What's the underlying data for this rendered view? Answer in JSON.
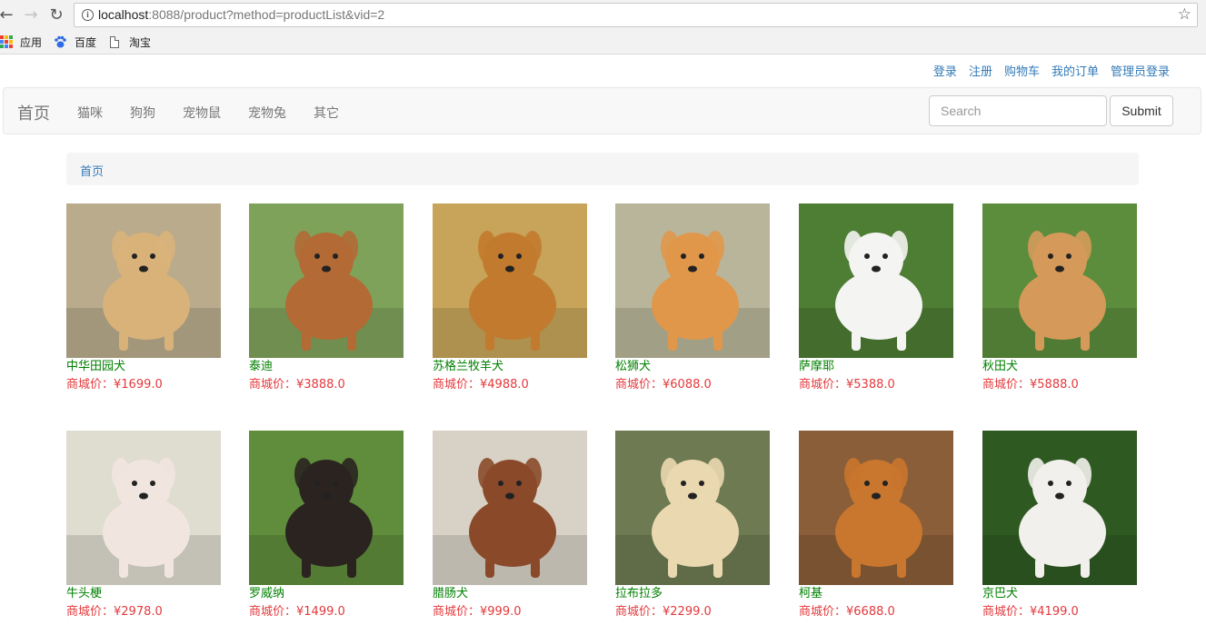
{
  "browser": {
    "url_host": "localhost",
    "url_rest": ":8088/product?method=productList&vid=2",
    "bookmarks": [
      {
        "label": "应用",
        "icon": "apps-grid-icon"
      },
      {
        "label": "百度",
        "icon": "baidu-paw-icon"
      },
      {
        "label": "淘宝",
        "icon": "page-icon"
      }
    ]
  },
  "toplinks": [
    "登录",
    "注册",
    "购物车",
    "我的订单",
    "管理员登录"
  ],
  "navbar": {
    "brand": "首页",
    "menu": [
      "猫咪",
      "狗狗",
      "宠物鼠",
      "宠物兔",
      "其它"
    ],
    "search_placeholder": "Search",
    "submit_label": "Submit"
  },
  "breadcrumb": "首页",
  "products": [
    {
      "name": "中华田园犬",
      "price": "商城价：¥1699.0",
      "image": "dog-photo",
      "bg": "#b9ab8c",
      "fur": "#d9b27a"
    },
    {
      "name": "泰迪",
      "price": "商城价：¥3888.0",
      "image": "dog-photo",
      "bg": "#7fa25a",
      "fur": "#b36a34"
    },
    {
      "name": "苏格兰牧羊犬",
      "price": "商城价：¥4988.0",
      "image": "dog-photo",
      "bg": "#c7a45a",
      "fur": "#c27a2e"
    },
    {
      "name": "松狮犬",
      "price": "商城价：¥6088.0",
      "image": "dog-photo",
      "bg": "#b9b59a",
      "fur": "#e0974a"
    },
    {
      "name": "萨摩耶",
      "price": "商城价：¥5388.0",
      "image": "dog-photo",
      "bg": "#4e7d34",
      "fur": "#f4f4f2"
    },
    {
      "name": "秋田犬",
      "price": "商城价：¥5888.0",
      "image": "dog-photo",
      "bg": "#5c8d3c",
      "fur": "#d59a5a"
    },
    {
      "name": "牛头梗",
      "price": "商城价：¥2978.0",
      "image": "dog-photo",
      "bg": "#dfdcd0",
      "fur": "#f1e6df"
    },
    {
      "name": "罗威纳",
      "price": "商城价：¥1499.0",
      "image": "dog-photo",
      "bg": "#5f8d3b",
      "fur": "#2a2320"
    },
    {
      "name": "腊肠犬",
      "price": "商城价：¥999.0",
      "image": "dog-photo",
      "bg": "#d8d2c6",
      "fur": "#8a4a2a"
    },
    {
      "name": "拉布拉多",
      "price": "商城价：¥2299.0",
      "image": "dog-photo",
      "bg": "#6e7a52",
      "fur": "#ead8b0"
    },
    {
      "name": "柯基",
      "price": "商城价：¥6688.0",
      "image": "dog-photo",
      "bg": "#8a5e38",
      "fur": "#c9762e"
    },
    {
      "name": "京巴犬",
      "price": "商城价：¥4199.0",
      "image": "dog-photo",
      "bg": "#2e5a22",
      "fur": "#f2f0ec"
    }
  ]
}
